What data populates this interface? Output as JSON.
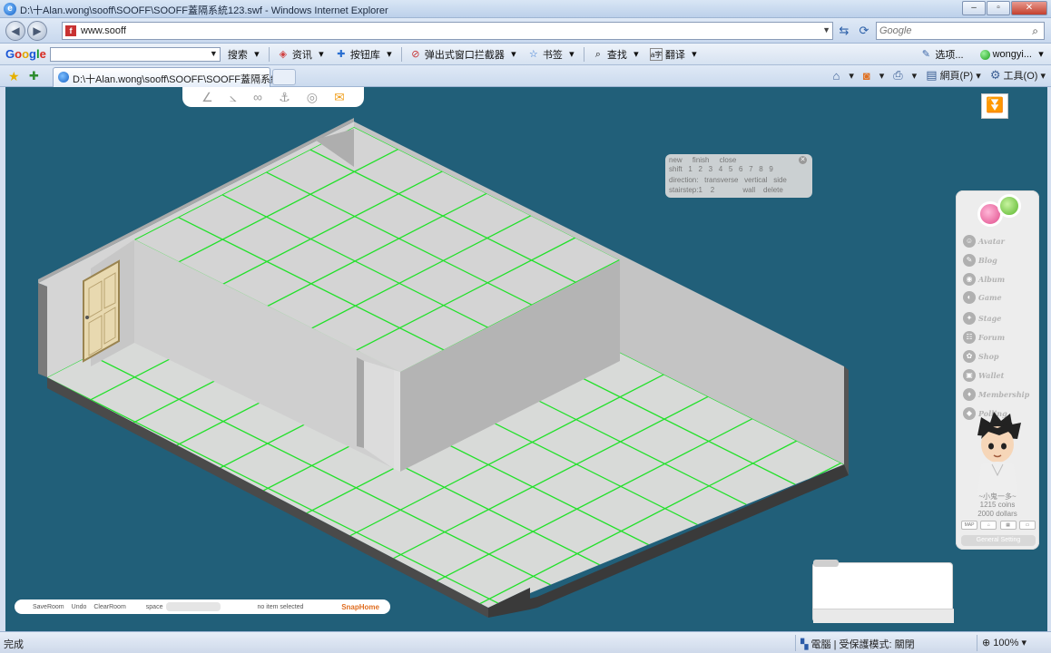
{
  "window": {
    "title": "D:\\十Alan.wong\\sooff\\SOOFF\\SOOFF蓋隔系統123.swf - Windows Internet Explorer"
  },
  "address": {
    "url": "www.sooff",
    "search_placeholder": "Google"
  },
  "google_toolbar": {
    "logo": [
      "G",
      "o",
      "o",
      "g",
      "l",
      "e"
    ],
    "search_button": "搜索",
    "items": [
      "资讯",
      "按钮库",
      "弹出式窗口拦截器",
      "书签",
      "查找",
      "翻译"
    ],
    "options_label": "选项...",
    "user_label": "wongyi..."
  },
  "tabs": {
    "active_label": "D:\\十Alan.wong\\sooff\\SOOFF\\SOOFF蓋隔系統..."
  },
  "command_bar": {
    "page_label": "網頁(P)",
    "tools_label": "工具(O)"
  },
  "build_panel": {
    "row1": [
      "new",
      "finish",
      "close"
    ],
    "row2_label": "shift",
    "row2_numbers": [
      "1",
      "2",
      "3",
      "4",
      "5",
      "6",
      "7",
      "8",
      "9"
    ],
    "row3": [
      "direction:",
      "transverse",
      "vertical",
      "side"
    ],
    "row4": [
      "stairstep:1",
      "2",
      "wall",
      "delete"
    ]
  },
  "sidebar": {
    "nav": [
      "Avatar",
      "Blog",
      "Album",
      "Game",
      "Stage",
      "Forum",
      "Shop",
      "Wallet",
      "Membership",
      "Polling"
    ],
    "nickname": "~小鬼一多~",
    "coins": "1215 coins",
    "dollars": "2000 dollars",
    "general_setting": "General Setting"
  },
  "bottom_bar": {
    "save": "SaveRoom",
    "undo": "Undo",
    "clear": "ClearRoom",
    "space": "space",
    "status": "no item selected",
    "snap": "SnapHome"
  },
  "status_bar": {
    "done": "完成",
    "zone": "電腦 | 受保護模式: 關閉",
    "zoom": "100%"
  },
  "colors": {
    "background": "#215f79",
    "grid_line": "#22e02a",
    "floor": "#d8dad8"
  }
}
